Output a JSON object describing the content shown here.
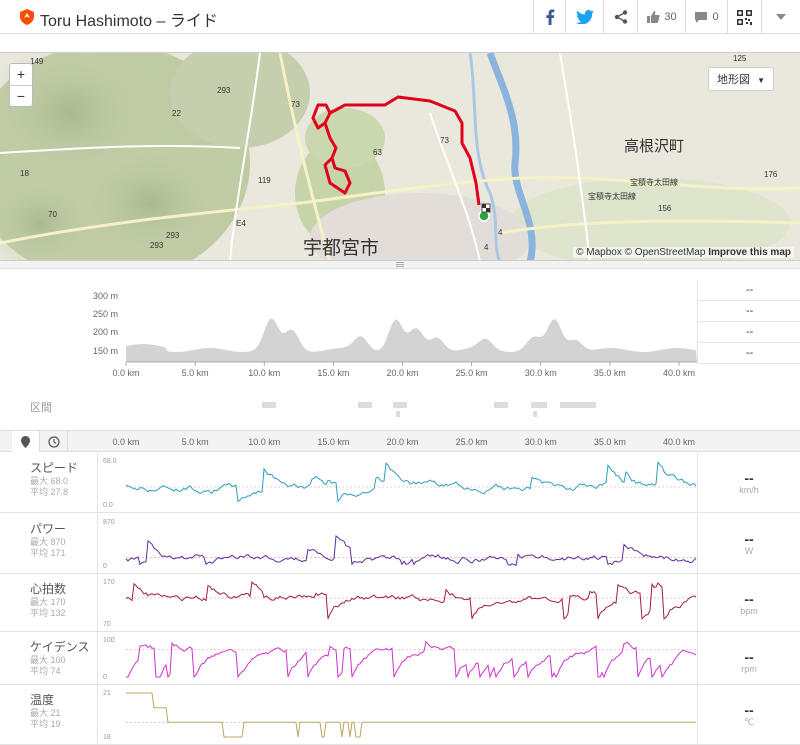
{
  "header": {
    "title": "Toru Hashimoto – ライド",
    "kudos_count": "30",
    "comment_count": "0"
  },
  "map": {
    "zoom_in": "+",
    "zoom_out": "−",
    "terrain_button": "地形図",
    "attribution_mapbox": "© Mapbox",
    "attribution_osm": "© OpenStreetMap",
    "attribution_improve": "Improve this map",
    "labels": {
      "city": "宇都宮市",
      "town": "高根沢町",
      "r293a": "293",
      "r293b": "293",
      "r293c": "293",
      "r22": "22",
      "r70": "70",
      "r119": "119",
      "r73a": "73",
      "r73b": "73",
      "r63": "63",
      "r4a": "4",
      "r4b": "4",
      "r176": "176",
      "r156": "156",
      "re4": "E4",
      "r149": "149",
      "r125": "125",
      "r18": "18",
      "rail1": "宝積寺太田線",
      "rail2": "宝積寺太田線"
    },
    "route_color": "#e0001b"
  },
  "elevation": {
    "y_ticks": [
      "300 m",
      "250 m",
      "200 m",
      "150 m"
    ],
    "x_ticks": [
      "0.0 km",
      "5.0 km",
      "10.0 km",
      "15.0 km",
      "20.0 km",
      "25.0 km",
      "30.0 km",
      "35.0 km",
      "40.0 km"
    ],
    "side_values": [
      "--",
      "--",
      "--",
      "--"
    ],
    "profile_color": "#d3d3d3"
  },
  "segments": {
    "label": "区間"
  },
  "streams_axis": {
    "x_ticks": [
      "0.0 km",
      "5.0 km",
      "10.0 km",
      "15.0 km",
      "20.0 km",
      "25.0 km",
      "30.0 km",
      "35.0 km",
      "40.0 km"
    ]
  },
  "streams": [
    {
      "name": "スピード",
      "max_label": "最大 68.0",
      "avg_label": "平均 27.8",
      "y_top": "68.0",
      "y_bottom": "0.0",
      "value": "--",
      "unit": "km/h",
      "color": "#2a9fbf",
      "max": 68.0,
      "avg": 27.8
    },
    {
      "name": "パワー",
      "max_label": "最大 870",
      "avg_label": "平均 171",
      "y_top": "870",
      "y_bottom": "0",
      "value": "--",
      "unit": "W",
      "color": "#5b2d9e",
      "max": 870,
      "avg": 171
    },
    {
      "name": "心拍数",
      "max_label": "最大 170",
      "avg_label": "平均 132",
      "y_top": "170",
      "y_bottom": "70",
      "value": "--",
      "unit": "bpm",
      "color": "#9e1d4a",
      "max": 170,
      "avg": 132
    },
    {
      "name": "ケイデンス",
      "max_label": "最大 100",
      "avg_label": "平均 74",
      "y_top": "100",
      "y_bottom": "0",
      "value": "--",
      "unit": "rpm",
      "color": "#cc33cc",
      "max": 100,
      "avg": 74
    },
    {
      "name": "温度",
      "max_label": "最大 21",
      "avg_label": "平均 19",
      "y_top": "21",
      "y_bottom": "18",
      "value": "--",
      "unit": "℃",
      "color": "#b8a860",
      "max": 21,
      "avg": 19
    }
  ]
}
